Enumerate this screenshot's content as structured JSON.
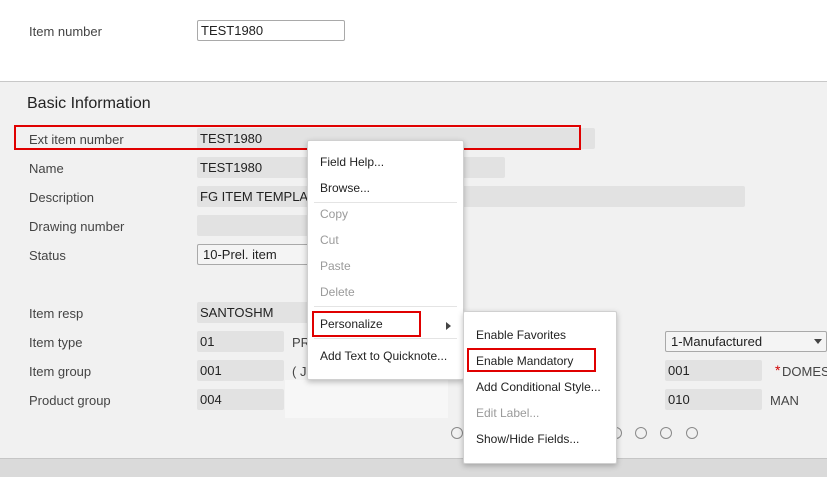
{
  "header": {
    "item_number_label": "Item number",
    "item_number_value": "TEST1980"
  },
  "section": {
    "title": "Basic Information"
  },
  "fields": {
    "ext_item_number": {
      "label": "Ext item number",
      "value": "TEST1980"
    },
    "name": {
      "label": "Name",
      "value": "TEST1980"
    },
    "description": {
      "label": "Description",
      "value": "FG ITEM TEMPLA"
    },
    "drawing_number": {
      "label": "Drawing number",
      "value": ""
    },
    "status": {
      "label": "Status",
      "value": "10-Prel. item"
    },
    "item_resp": {
      "label": "Item resp",
      "value": "SANTOSHM"
    },
    "item_type": {
      "label": "Item type",
      "value": "01",
      "extra": "PR",
      "right_select": "1-Manufactured"
    },
    "item_group": {
      "label": "Item group",
      "value": "001",
      "extra": "( J",
      "right_value": "001",
      "right_text": "DOMES",
      "required_mark": "*"
    },
    "product_group": {
      "label": "Product group",
      "value": "004",
      "right_value": "010",
      "right_text": "MAN"
    }
  },
  "context_menu": {
    "items": [
      {
        "label": "Field Help...",
        "disabled": false
      },
      {
        "label": "Browse...",
        "disabled": false
      },
      {
        "label": "Copy",
        "disabled": true
      },
      {
        "label": "Cut",
        "disabled": true
      },
      {
        "label": "Paste",
        "disabled": true
      },
      {
        "label": "Delete",
        "disabled": true
      },
      {
        "label": "Personalize",
        "disabled": false,
        "submenu": true
      },
      {
        "label": "Add Text to Quicknote...",
        "disabled": false
      }
    ]
  },
  "submenu": {
    "items": [
      {
        "label": "Enable Favorites",
        "disabled": false
      },
      {
        "label": "Enable Mandatory",
        "disabled": false
      },
      {
        "label": "Add Conditional Style...",
        "disabled": false
      },
      {
        "label": "Edit Label...",
        "disabled": true
      },
      {
        "label": "Show/Hide Fields...",
        "disabled": false
      }
    ]
  },
  "colors": {
    "highlight": "#e00000",
    "field_bg": "#e2e2e2",
    "page_bg": "#f1f1f1"
  }
}
